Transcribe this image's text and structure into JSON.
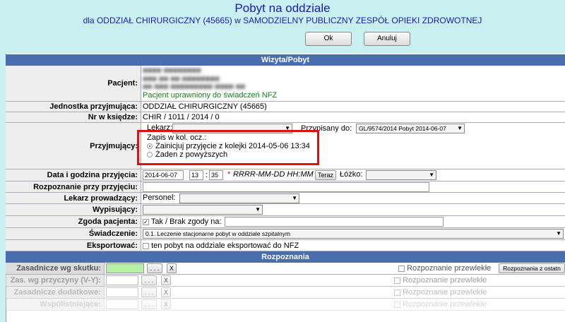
{
  "header": {
    "title": "Pobyt na oddziale",
    "subtitle": "dla ODDZIAŁ CHIRURGICZNY (45665) w SAMODZIELNY PUBLICZNY ZESPÓŁ OPIEKI ZDROWOTNEJ",
    "ok_label": "Ok",
    "cancel_label": "Anuluj"
  },
  "visit_section": {
    "title": "Wizyta/Pobyt"
  },
  "form": {
    "patient": {
      "label": "Pacjent:",
      "status": "Pacjent uprawniony do świadczeń NFZ"
    },
    "receiving_unit": {
      "label": "Jednostka przyjmująca:",
      "value": "ODDZIAŁ CHIRURGICZNY (45665)"
    },
    "book_number": {
      "label": "Nr w księdze:",
      "value": "CHIR / 1011 / 2014 / 0"
    },
    "admitting": {
      "label": "Przyjmujący:",
      "doctor_label": "Lekarz:",
      "assigned_label": "Przypisany do:",
      "assigned_value": "GL/9574/2014 Pobyt 2014-06-07",
      "queue_label": "Zapis w kol. ocz.:",
      "option1": "Zainicjuj przyjęcie z kolejki 2014-05-06 13:34",
      "option2": "Żaden z powyższych"
    },
    "admission_date": {
      "label": "Data i godzina przyjęcia:",
      "date": "2014-06-07",
      "hour": "13",
      "minute": "35",
      "format_hint": "RRRR-MM-DD HH:MM",
      "now_label": "Teraz",
      "bed_label": "Łóżko:"
    },
    "admission_diagnosis": {
      "label": "Rozpoznanie przy przyjęciu:"
    },
    "lead_doctor": {
      "label": "Lekarz prowadzący:",
      "personnel_label": "Personel:"
    },
    "discharging": {
      "label": "Wypisujący:"
    },
    "patient_consent": {
      "label": "Zgoda pacjenta:",
      "text": "Tak / Brak zgody na:"
    },
    "service": {
      "label": "Świadczenie:",
      "value": "0.1. Leczenie stacjonarne pobyt w oddziale szpitalnym"
    },
    "export": {
      "label": "Eksportować:",
      "text": "ten pobyt na oddziale eksportować do NFZ"
    }
  },
  "diagnosis_section": {
    "title": "Rozpoznania",
    "rows": [
      {
        "label": "Zasadnicze wg skutku:",
        "browse": ". . .",
        "clear": "X",
        "chronic": "Rozpoznanie przewlekłe",
        "extra_button": "Rozpoznania z ostatn"
      },
      {
        "label": "Zas. wg przyczyny (V-Y):",
        "browse": ". . .",
        "clear": "X",
        "chronic": "Rozpoznanie przewlekłe"
      },
      {
        "label": "Zasadnicze dodatkowe:",
        "browse": ". . .",
        "clear": "X",
        "chronic": "Rozpoznanie przewlekłe"
      },
      {
        "label": "Współistniejące:",
        "browse": ". . .",
        "clear": "X",
        "chronic": "Rozpoznanie przewlekłe"
      }
    ]
  }
}
